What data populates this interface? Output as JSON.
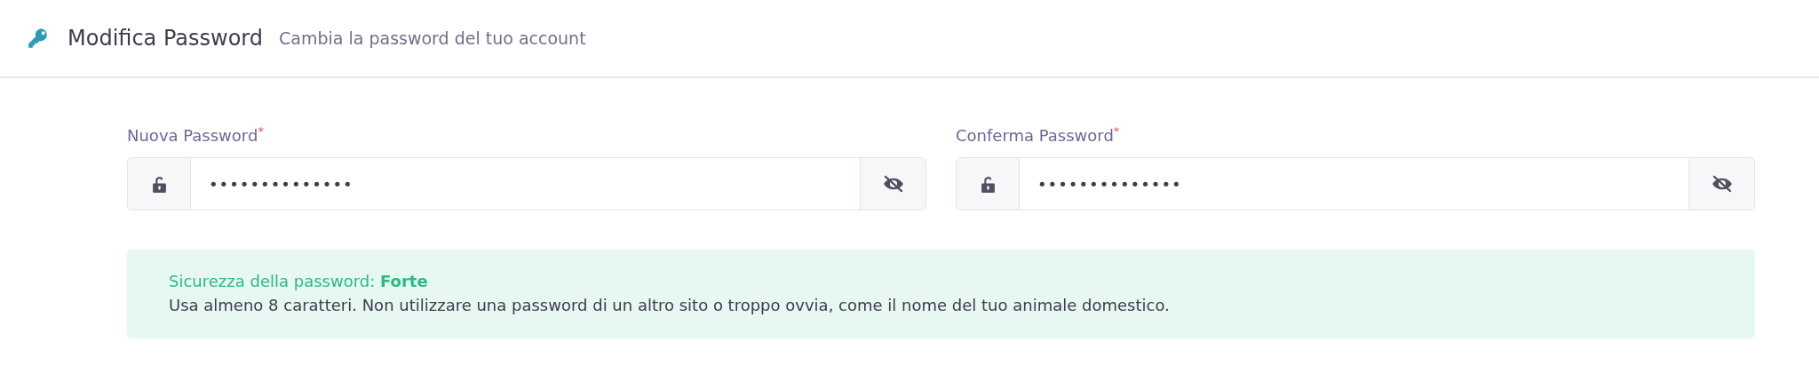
{
  "header": {
    "title": "Modifica Password",
    "subtitle": "Cambia la password del tuo account"
  },
  "fields": [
    {
      "label": "Nuova Password",
      "required_mark": "*",
      "value": "••••••••••••••"
    },
    {
      "label": "Conferma Password",
      "required_mark": "*",
      "value": "••••••••••••••"
    }
  ],
  "strength": {
    "label": "Sicurezza della password:",
    "value": "Forte",
    "text": "Usa almeno 8 caratteri. Non utilizzare una password di un altro sito o troppo ovvia, come il nome del tuo animale domestico."
  }
}
